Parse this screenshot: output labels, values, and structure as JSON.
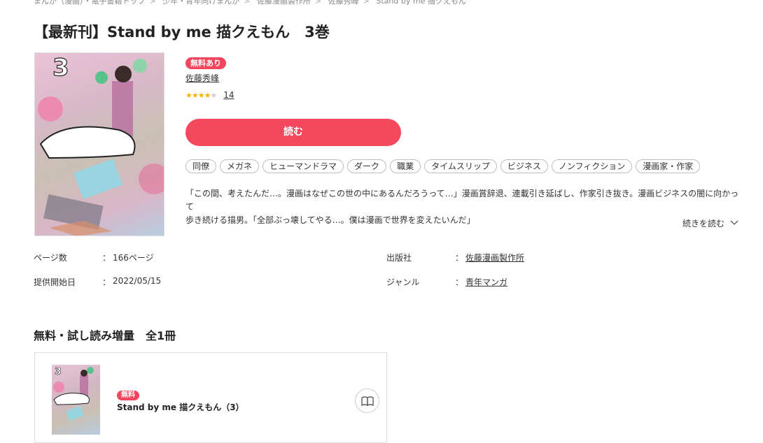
{
  "breadcrumb": [
    "まんが（漫画）・電子書籍トップ",
    "少年・青年向けまんが",
    "佐藤漫画製作所",
    "佐藤秀峰",
    "Stand by me 描クえもん"
  ],
  "breadcrumb_separator": ">",
  "title": "【最新刊】Stand by me 描クえもん　3巻",
  "cover": {
    "volume_number": "3"
  },
  "free_badge": "無料あり",
  "author": "佐藤秀峰",
  "rating": {
    "stars": 4,
    "max": 5,
    "count": "14"
  },
  "read_button": "読む",
  "tags": [
    "同僚",
    "メガネ",
    "ヒューマンドラマ",
    "ダーク",
    "職業",
    "タイムスリップ",
    "ビジネス",
    "ノンフィクション",
    "漫画家・作家"
  ],
  "description_line1": "「この間、考えたんだ…。漫画はなぜこの世の中にあるんだろうって…」漫画賞辞退、連載引き延ばし、作家引き抜き。漫画ビジネスの闇に向かって",
  "description_line2": "歩き続ける描男。「全部ぶっ壊してやる…。僕は漫画で世界を変えたいんだ」",
  "read_more": "続きを読む",
  "meta": {
    "pages_label": "ページ数",
    "pages_value": "166ページ",
    "start_label": "提供開始日",
    "start_value": "2022/05/15",
    "publisher_label": "出版社",
    "publisher_value": "佐藤漫画製作所",
    "genre_label": "ジャンル",
    "genre_value": "青年マンガ",
    "colon": "："
  },
  "free_section": {
    "title": "無料・試し読み増量　全1冊",
    "item": {
      "badge": "無料",
      "title": "Stand by me 描クえもん（3）"
    }
  },
  "colors": {
    "accent": "#f5485e",
    "star": "#f5b400"
  }
}
